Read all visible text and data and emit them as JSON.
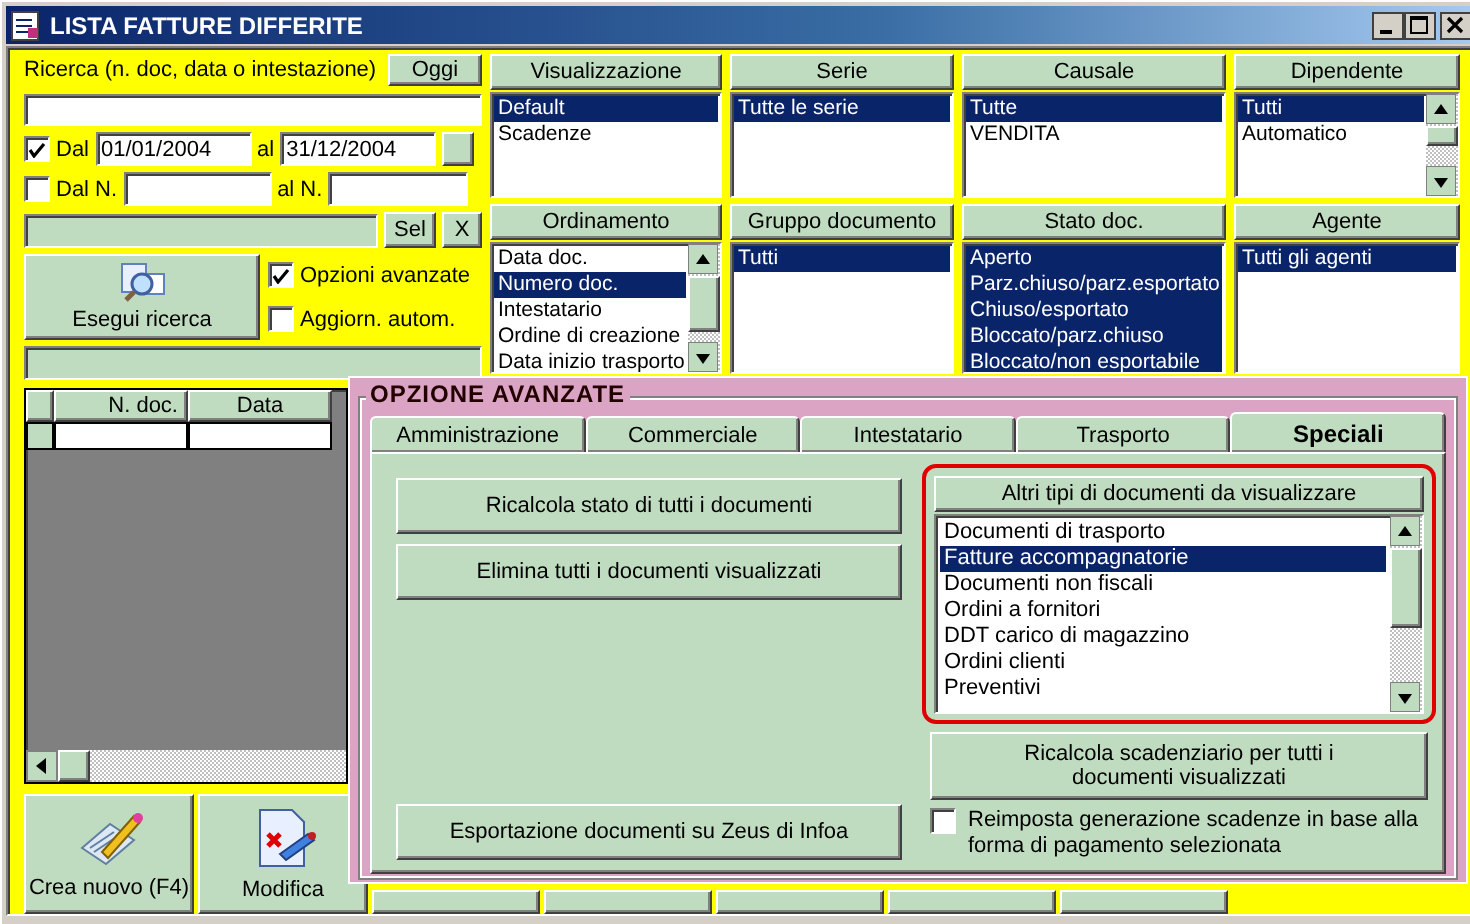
{
  "window": {
    "title": "LISTA FATTURE DIFFERITE"
  },
  "search": {
    "label": "Ricerca (n. doc, data o intestazione)",
    "today_button": "Oggi"
  },
  "date_range": {
    "checked": true,
    "from_label": "Dal",
    "from": "01/01/2004",
    "to_label": "al",
    "to": "31/12/2004"
  },
  "number_range": {
    "checked": false,
    "from_label": "Dal N.",
    "to_label": "al N."
  },
  "select_button": "Sel",
  "clear_button": "X",
  "search_button": "Esegui ricerca",
  "options": [
    {
      "label": "Opzioni avanzate",
      "checked": true
    },
    {
      "label": "Aggiorn. autom.",
      "checked": false
    }
  ],
  "filters": [
    {
      "title": "Visualizzazione",
      "scrollable": false,
      "items": [
        {
          "label": "Default",
          "selected": true
        },
        {
          "label": "Scadenze",
          "selected": false
        }
      ]
    },
    {
      "title": "Serie",
      "scrollable": false,
      "items": [
        {
          "label": "Tutte le serie",
          "selected": true
        }
      ]
    },
    {
      "title": "Causale",
      "scrollable": false,
      "items": [
        {
          "label": "Tutte",
          "selected": true
        },
        {
          "label": "VENDITA",
          "selected": false
        }
      ]
    },
    {
      "title": "Dipendente",
      "scrollable": true,
      "items": [
        {
          "label": "Tutti",
          "selected": true
        },
        {
          "label": "Automatico",
          "selected": false
        }
      ]
    },
    {
      "title": "Ordinamento",
      "scrollable": true,
      "items": [
        {
          "label": "Data doc.",
          "selected": false
        },
        {
          "label": "Numero doc.",
          "selected": true
        },
        {
          "label": "Intestatario",
          "selected": false
        },
        {
          "label": "Ordine di creazione",
          "selected": false
        },
        {
          "label": "Data inizio trasporto",
          "selected": false
        }
      ]
    },
    {
      "title": "Gruppo documento",
      "scrollable": false,
      "items": [
        {
          "label": "Tutti",
          "selected": true
        }
      ]
    },
    {
      "title": "Stato doc.",
      "scrollable": false,
      "items": [
        {
          "label": "Aperto",
          "selected": true
        },
        {
          "label": "Parz.chiuso/parz.esportato",
          "selected": true
        },
        {
          "label": "Chiuso/esportato",
          "selected": true
        },
        {
          "label": "Bloccato/parz.chiuso",
          "selected": true
        },
        {
          "label": "Bloccato/non esportabile",
          "selected": true
        }
      ]
    },
    {
      "title": "Agente",
      "scrollable": false,
      "items": [
        {
          "label": "Tutti gli agenti",
          "selected": true
        }
      ]
    }
  ],
  "grid": {
    "columns": [
      "N. doc.",
      "Data"
    ]
  },
  "toolbar": [
    {
      "label": "Crea nuovo (F4)",
      "kind": "new"
    },
    {
      "label": "Modifica",
      "kind": "edit"
    }
  ],
  "advanced": {
    "title": "OPZIONE AVANZATE",
    "tabs": [
      {
        "label": "Amministrazione",
        "selected": false
      },
      {
        "label": "Commerciale",
        "selected": false
      },
      {
        "label": "Intestatario",
        "selected": false
      },
      {
        "label": "Trasporto",
        "selected": false
      },
      {
        "label": "Speciali",
        "selected": true
      }
    ],
    "actions": [
      "Ricalcola stato di tutti i documenti",
      "Elimina tutti i documenti visualizzati"
    ],
    "export_button": "Esportazione documenti su Zeus di Infoa",
    "doc_types": {
      "title": "Altri tipi di documenti da visualizzare",
      "items": [
        {
          "label": "Documenti di trasporto",
          "selected": false
        },
        {
          "label": "Fatture accompagnatorie",
          "selected": true
        },
        {
          "label": "Documenti non fiscali",
          "selected": false
        },
        {
          "label": "Ordini a fornitori",
          "selected": false
        },
        {
          "label": "DDT carico di magazzino",
          "selected": false
        },
        {
          "label": "Ordini clienti",
          "selected": false
        },
        {
          "label": "Preventivi",
          "selected": false
        }
      ]
    },
    "recalc_button": "Ricalcola scadenziario per tutti i documenti visualizzati",
    "reset_option": {
      "label": "Reimposta generazione scadenze in base alla forma di pagamento selezionata",
      "checked": false
    }
  }
}
